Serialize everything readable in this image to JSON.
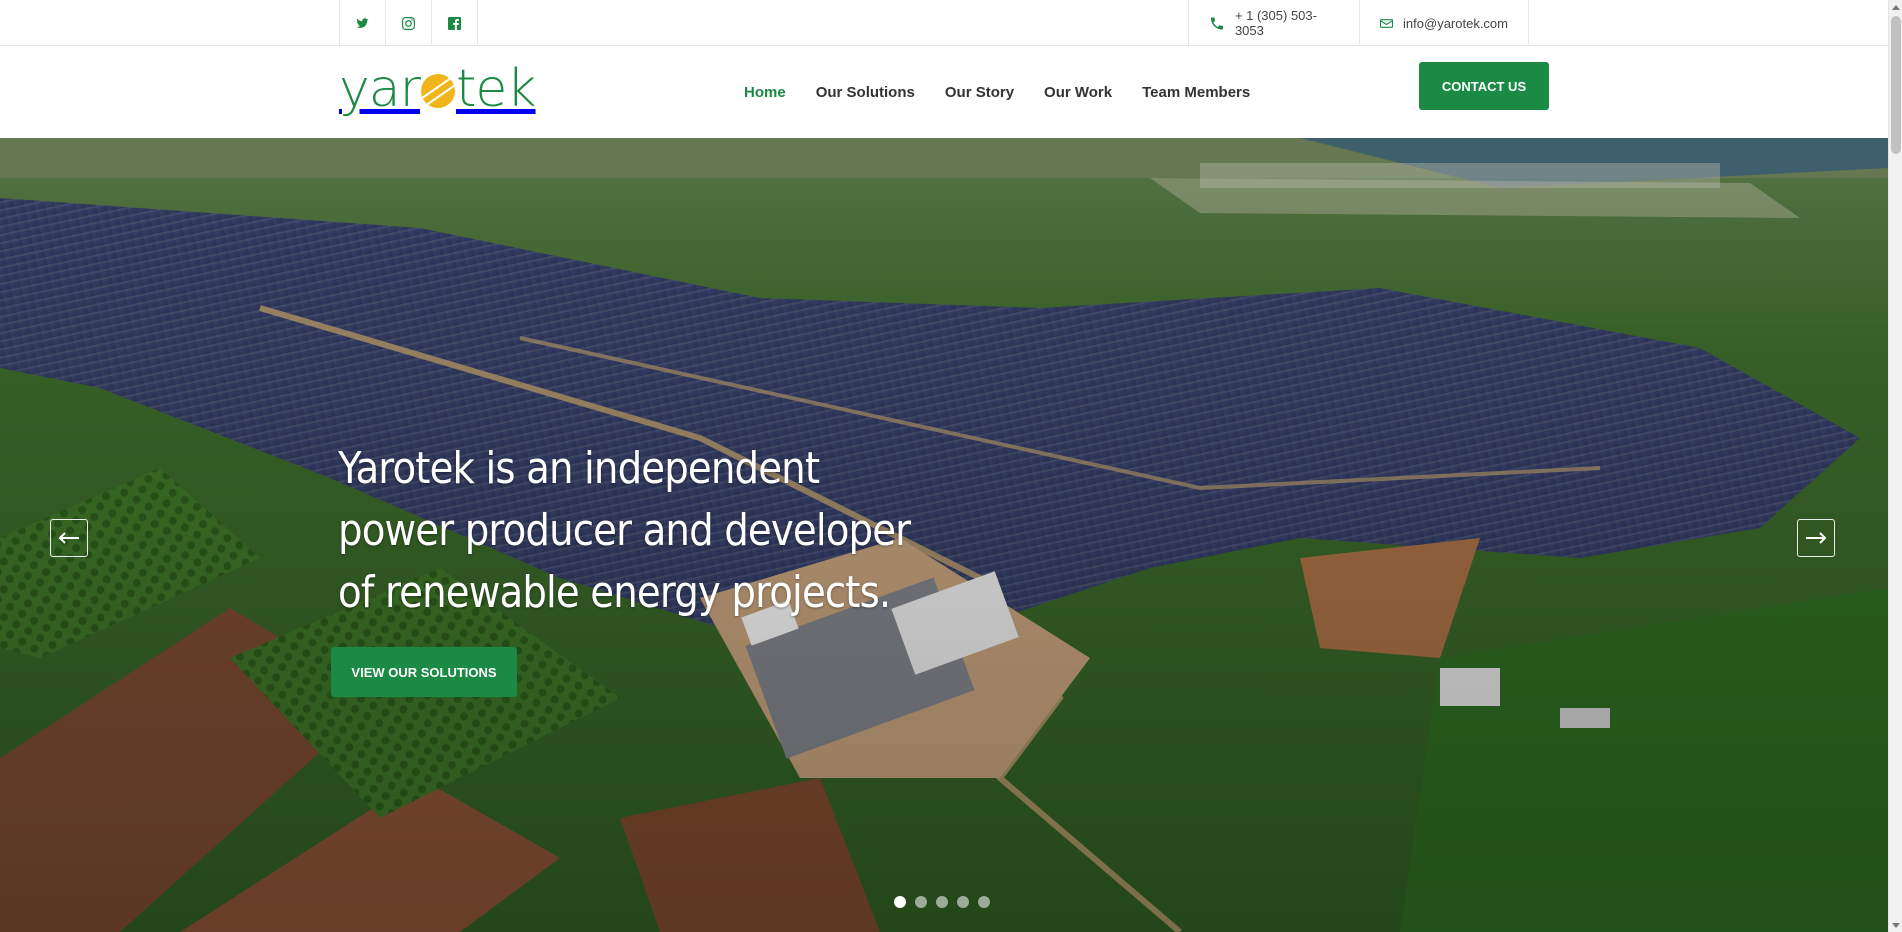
{
  "topbar": {
    "social": [
      {
        "icon": "twitter-icon"
      },
      {
        "icon": "instagram-icon"
      },
      {
        "icon": "facebook-icon"
      }
    ],
    "phone": "+ 1 (305) 503-3053",
    "email": "info@yarotek.com"
  },
  "header": {
    "logo": {
      "text_left": "yar",
      "text_right": "tek"
    },
    "nav": [
      {
        "label": "Home",
        "active": true
      },
      {
        "label": "Our Solutions",
        "active": false
      },
      {
        "label": "Our Story",
        "active": false
      },
      {
        "label": "Our Work",
        "active": false
      },
      {
        "label": "Team Members",
        "active": false
      }
    ],
    "contact_button": "CONTACT US"
  },
  "hero": {
    "title": "Yarotek is an independent power producer and developer of renewable energy projects.",
    "cta": "VIEW OUR SOLUTIONS",
    "slides_total": 5,
    "active_slide": 1
  },
  "colors": {
    "brand_green": "#1a8a44",
    "brand_yellow": "#f0b51b"
  }
}
